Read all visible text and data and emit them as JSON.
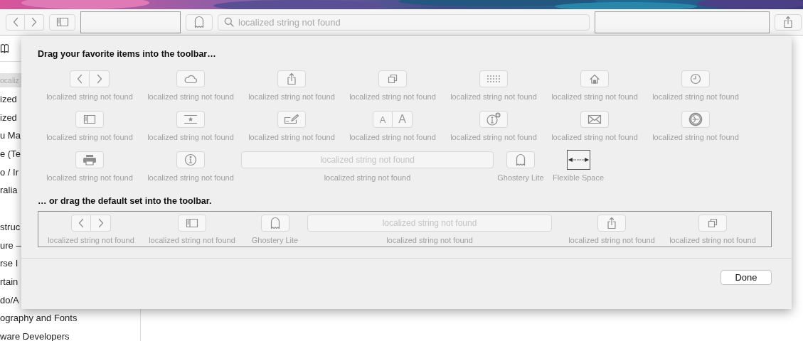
{
  "toolbar": {
    "items": [
      {
        "kind": "nav"
      },
      {
        "kind": "sidebar"
      },
      {
        "kind": "space"
      },
      {
        "kind": "ghost"
      },
      {
        "kind": "search",
        "placeholder": "localized string not found"
      },
      {
        "kind": "space"
      },
      {
        "kind": "share"
      }
    ]
  },
  "sidebar": {
    "search": {
      "placeholder": "ocaliz"
    },
    "sections": [
      {
        "items": [
          {
            "label": "ized"
          },
          {
            "label": "ized"
          },
          {
            "label": "u Ma"
          },
          {
            "label": "e (Te"
          },
          {
            "label": "o / Ir"
          },
          {
            "label": "ralia"
          }
        ]
      },
      {
        "items": [
          {
            "label": "struc"
          },
          {
            "label": "ure –"
          },
          {
            "label": "rse I"
          },
          {
            "label": "rtain"
          },
          {
            "label": "do/A"
          },
          {
            "label": "ography and Fonts"
          },
          {
            "label": "ware Developers"
          }
        ]
      }
    ]
  },
  "sheet": {
    "title": "Drag your favorite items into the toolbar…",
    "items": [
      {
        "kind": "nav",
        "label": "localized string not found"
      },
      {
        "kind": "cloud",
        "label": "localized string not found"
      },
      {
        "kind": "share",
        "label": "localized string not found"
      },
      {
        "kind": "tabs",
        "label": "localized string not found"
      },
      {
        "kind": "grid",
        "label": "localized string not found"
      },
      {
        "kind": "home",
        "label": "localized string not found"
      },
      {
        "kind": "clock",
        "label": "localized string not found"
      },
      {
        "kind": "sidebar",
        "label": "localized string not found"
      },
      {
        "kind": "bookmark",
        "label": "localized string not found"
      },
      {
        "kind": "edit",
        "label": "localized string not found"
      },
      {
        "kind": "textsize",
        "label": "localized string not found",
        "glyphs": [
          "A",
          "A"
        ]
      },
      {
        "kind": "readerplus",
        "label": "localized string not found"
      },
      {
        "kind": "mail",
        "label": "localized string not found"
      },
      {
        "kind": "gear",
        "label": "localized string not found"
      },
      {
        "kind": "print",
        "label": "localized string not found"
      },
      {
        "kind": "info",
        "label": "localized string not found"
      },
      {
        "kind": "search",
        "label": "localized string not found",
        "placeholder": "localized string not found"
      },
      {
        "kind": "ghost",
        "label": "Ghostery Lite"
      },
      {
        "kind": "flex",
        "label": "Flexible Space"
      }
    ],
    "default_title": "… or drag the default set into the toolbar.",
    "default_items": [
      {
        "kind": "nav",
        "label": "localized string not found"
      },
      {
        "kind": "sidebar",
        "label": "localized string not found"
      },
      {
        "kind": "ghost",
        "label": "Ghostery Lite"
      },
      {
        "kind": "search",
        "label": "localized string not found",
        "placeholder": "localized string not found"
      },
      {
        "kind": "share",
        "label": "localized string not found"
      },
      {
        "kind": "tabs",
        "label": "localized string not found"
      }
    ],
    "done_button": "Done"
  }
}
